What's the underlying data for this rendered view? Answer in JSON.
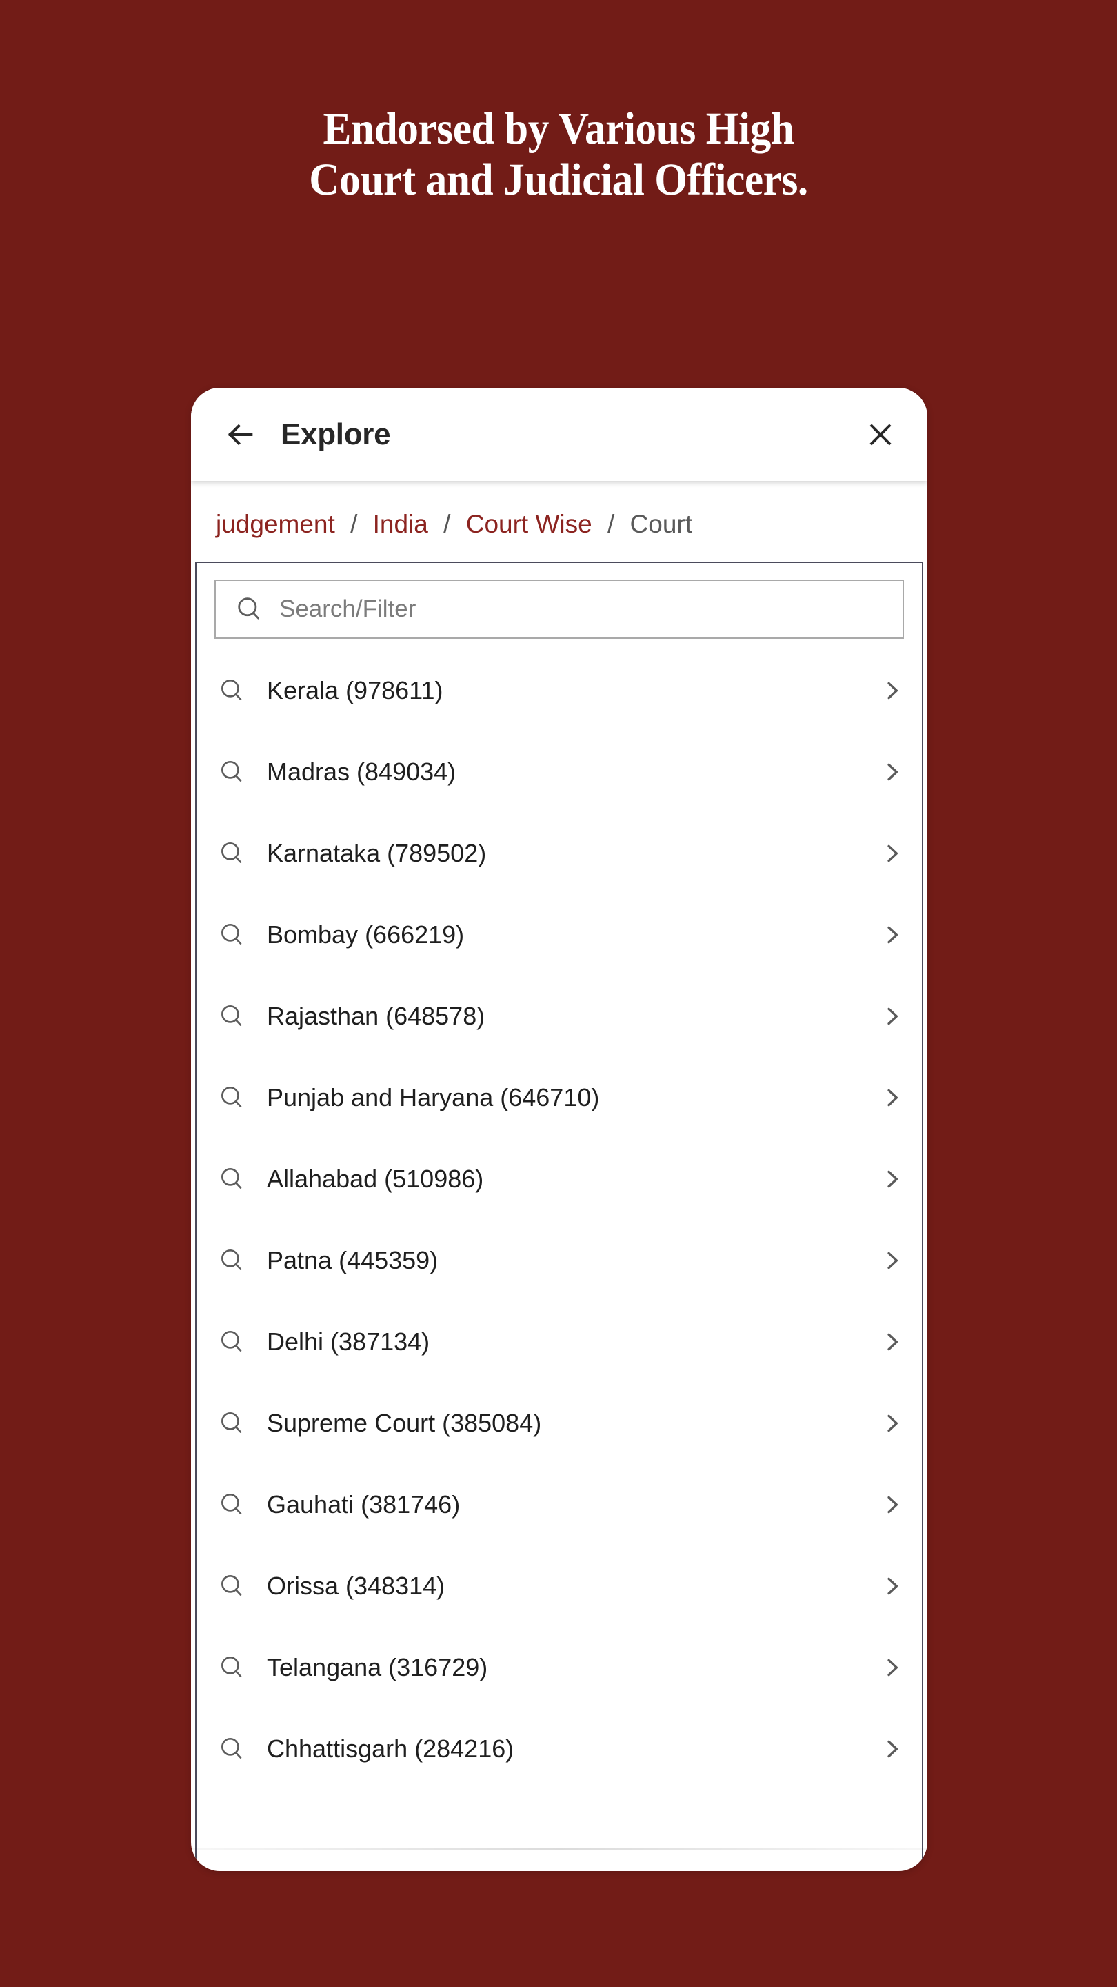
{
  "headline": {
    "line1": "Endorsed by Various High",
    "line2": "Court and Judicial Officers."
  },
  "colors": {
    "background": "#721C17",
    "breadcrumb_link": "#8C2420",
    "breadcrumb_current": "#5a5a5a",
    "panel_border": "#4B4B5C",
    "search_border": "#A9A9A9",
    "title_text": "#272727"
  },
  "appbar": {
    "title": "Explore",
    "back_icon": "arrow-left-icon",
    "close_icon": "close-icon"
  },
  "breadcrumb": {
    "separator": "/",
    "items": [
      {
        "label": "judgement",
        "current": false
      },
      {
        "label": "India",
        "current": false
      },
      {
        "label": "Court Wise",
        "current": false
      },
      {
        "label": "Court",
        "current": true
      }
    ]
  },
  "search": {
    "placeholder": "Search/Filter",
    "value": "",
    "icon": "search-icon"
  },
  "list": {
    "row_icon": "search-icon",
    "row_chevron": "chevron-right-icon",
    "items": [
      {
        "label": "Kerala (978611)",
        "name": "Kerala",
        "count": 978611
      },
      {
        "label": "Madras (849034)",
        "name": "Madras",
        "count": 849034
      },
      {
        "label": "Karnataka (789502)",
        "name": "Karnataka",
        "count": 789502
      },
      {
        "label": "Bombay (666219)",
        "name": "Bombay",
        "count": 666219
      },
      {
        "label": "Rajasthan (648578)",
        "name": "Rajasthan",
        "count": 648578
      },
      {
        "label": "Punjab and Haryana (646710)",
        "name": "Punjab and Haryana",
        "count": 646710
      },
      {
        "label": "Allahabad (510986)",
        "name": "Allahabad",
        "count": 510986
      },
      {
        "label": "Patna (445359)",
        "name": "Patna",
        "count": 445359
      },
      {
        "label": "Delhi (387134)",
        "name": "Delhi",
        "count": 387134
      },
      {
        "label": "Supreme Court (385084)",
        "name": "Supreme Court",
        "count": 385084
      },
      {
        "label": "Gauhati (381746)",
        "name": "Gauhati",
        "count": 381746
      },
      {
        "label": "Orissa (348314)",
        "name": "Orissa",
        "count": 348314
      },
      {
        "label": "Telangana (316729)",
        "name": "Telangana",
        "count": 316729
      },
      {
        "label": "Chhattisgarh (284216)",
        "name": "Chhattisgarh",
        "count": 284216
      }
    ]
  }
}
